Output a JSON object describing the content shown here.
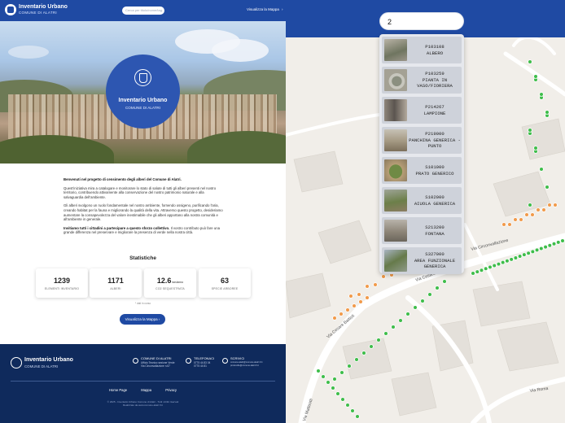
{
  "landing": {
    "header": {
      "title": "Inventario Urbano",
      "subtitle": "COMUNE DI ALATRI",
      "search_placeholder": "Cerca per titolo/nome/tag...",
      "map_link": "Visualizza la Mappa",
      "map_link_icon": "chevron-right-icon"
    },
    "hero": {
      "title": "Inventario Urbano",
      "subtitle": "COMUNE DI ALATRI",
      "emblem": "city-crest-icon"
    },
    "intro": {
      "heading": "Benvenuti nel progetto di censimento degli alberi del Comune di Alatri.",
      "p1": "Quest'iniziativa mira a catalogare e monitorare lo stato di salute di tutti gli alberi presenti nel nostro territorio, contribuendo attivamente alla conservazione del nostro patrimonio naturale e alla salvaguardia dell'ambiente.",
      "p2": "Gli alberi svolgono un ruolo fondamentale nel nostro ambiente, fornendo ossigeno, purificando l'aria, creando habitat per la fauna e migliorando la qualità della vita. Attraverso questo progetto, desideriamo aumentare la consapevolezza del valore inestimabile che gli alberi apportano alla nostra comunità e all'ambiente in generale.",
      "p3_bold": "Invitiamo tutti i cittadini a partecipare a questo sforzo collettivo.",
      "p3_rest": " Il vostro contributo può fare una grande differenza nel preservare e migliorare la presenza di verde nella nostra città."
    },
    "stats": {
      "title": "Statistiche",
      "items": [
        {
          "value": "1239",
          "unit": "",
          "label": "ELEMENTI INVENTARIO"
        },
        {
          "value": "1171",
          "unit": "",
          "label": "ALBERI"
        },
        {
          "value": "12.6",
          "unit": "ton/anno",
          "label": "CO2 SEQUESTRATA"
        },
        {
          "value": "63",
          "unit": "",
          "label": "SPECIE ARBOREE"
        }
      ],
      "note": "* dati in corso",
      "cta": "Visualizza la Mappa",
      "cta_icon": "chevron-right-icon"
    },
    "footer": {
      "title": "Inventario Urbano",
      "subtitle": "COMUNE DI ALATRI",
      "contacts": [
        {
          "icon": "location-pin-icon",
          "title": "COMUNE DI ALATRI",
          "detail": "Ufficio Tecnico sezione Verde\nVia Circonvallazione n.67"
        },
        {
          "icon": "phone-icon",
          "title": "TELEFONACI",
          "detail": "0775 44 83 04\n0775 44 81"
        },
        {
          "icon": "mail-icon",
          "title": "SCRIVICI",
          "detail": "comune.alatri@comune.alatri.fr.it\nprotocollo@comune.alatri.fr.it"
        }
      ],
      "links": [
        "Home Page",
        "Mappa",
        "Privacy"
      ],
      "copyright": "© 2025 - Inventario Urbano Comune di Alatri - Tutti i diritti riservati\nRealizzato da www.comune.alatri.fr.it"
    }
  },
  "map_app": {
    "search_value": "2",
    "results": [
      {
        "code": "P103108",
        "name": "ALBERO",
        "thumb": "tree-photo"
      },
      {
        "code": "P103259",
        "name": "PIANTA IN VASO/FIORIERA",
        "thumb": "planter-photo"
      },
      {
        "code": "P214267",
        "name": "LAMPIONE",
        "thumb": "street-lamp-photo"
      },
      {
        "code": "P219000",
        "name": "PANCHINA GENERICA - PUNTO",
        "thumb": "bench-photo"
      },
      {
        "code": "S101000",
        "name": "PRATO GENERICO",
        "thumb": "lawn-photo"
      },
      {
        "code": "S102000",
        "name": "AIUOLA GENERICA",
        "thumb": "flowerbed-photo"
      },
      {
        "code": "S213200",
        "name": "FONTANA",
        "thumb": "fountain-photo"
      },
      {
        "code": "S327000",
        "name": "AREA FUNZIONALE GENERICA",
        "thumb": "functional-area-photo"
      }
    ],
    "streets": [
      "Via Circonvallazione",
      "Via Cesare Battisti",
      "Via Roma",
      "Via Cesare",
      "Via Matteotti"
    ],
    "colors": {
      "tree_marker": "#3ebd4a",
      "other_marker": "#f19a4a",
      "header": "#1f4aa3"
    }
  }
}
